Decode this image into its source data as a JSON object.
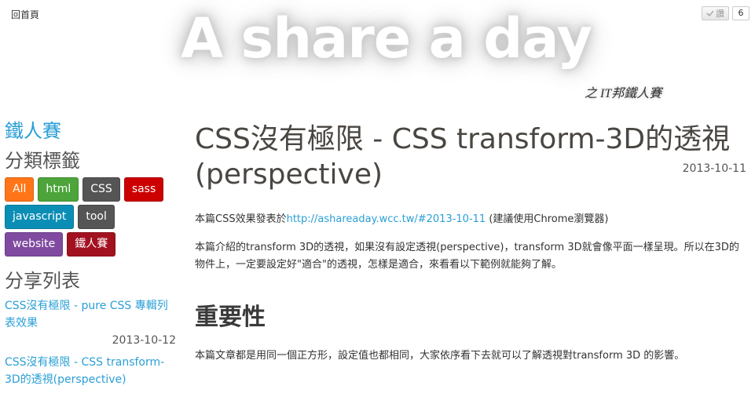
{
  "header": {
    "home_link": "回首頁",
    "site_title": "A share a day",
    "site_subtitle": "之  IT邦鐵人賽",
    "like_label": "讚",
    "like_count": "6"
  },
  "sidebar": {
    "contest_link": "鐵人賽",
    "tags_heading": "分類標籤",
    "tags": [
      {
        "label": "All",
        "color": "#ff7518"
      },
      {
        "label": "html",
        "color": "#4ca43a"
      },
      {
        "label": "CSS",
        "color": "#555555"
      },
      {
        "label": "sass",
        "color": "#cc0000"
      },
      {
        "label": "javascript",
        "color": "#0b8eb5"
      },
      {
        "label": "tool",
        "color": "#555555"
      },
      {
        "label": "website",
        "color": "#7f4aa0"
      },
      {
        "label": "鐵人賽",
        "color": "#a2111f"
      }
    ],
    "share_heading": "分享列表",
    "shares": [
      {
        "title": "CSS沒有極限 - pure CSS 專輯列表效果",
        "date": "2013-10-12"
      },
      {
        "title": "CSS沒有極限 - CSS transform-3D的透視(perspective)",
        "date": ""
      }
    ]
  },
  "article": {
    "title": "CSS沒有極限 - CSS transform-3D的透視(perspective)",
    "date": "2013-10-11",
    "intro_prefix": "本篇CSS效果發表於",
    "intro_link": "http://ashareaday.wcc.tw/#2013-10-11",
    "intro_suffix": " (建議使用Chrome瀏覽器)",
    "paragraph2": "本篇介紹的transform  3D的透視，如果沒有設定透視(perspective)，transform  3D就會像平面一樣呈現。所以在3D的物件上，一定要設定好\"適合\"的透視，怎樣是適合，來看看以下範例就能夠了解。",
    "section_heading": "重要性",
    "section_paragraph": "本篇文章都是用同一個正方形，設定值也都相同，大家依序看下去就可以了解透視對transform 3D 的影響。"
  }
}
